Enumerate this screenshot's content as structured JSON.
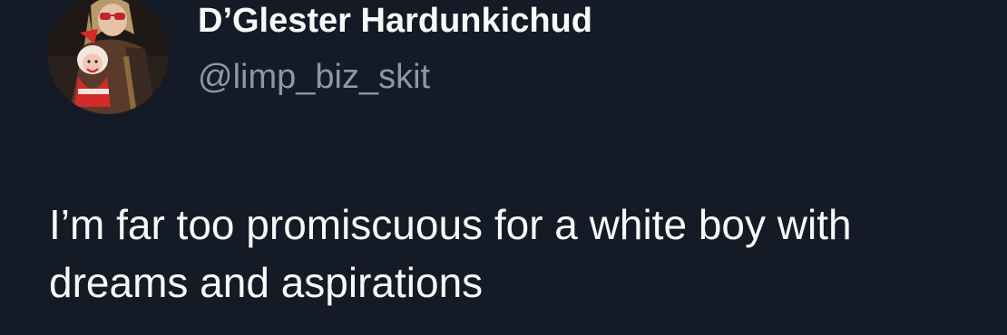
{
  "tweet": {
    "author": {
      "display_name": "D’Glester Hardunkichud",
      "handle": "@limp_biz_skit",
      "avatar_icon": "profile-photo"
    },
    "text": "I’m far too promiscuous for a white boy with\ndreams and aspirations"
  },
  "colors": {
    "background": "#151b26",
    "primary_text": "#f7f9f9",
    "secondary_text": "#8b98a5"
  }
}
